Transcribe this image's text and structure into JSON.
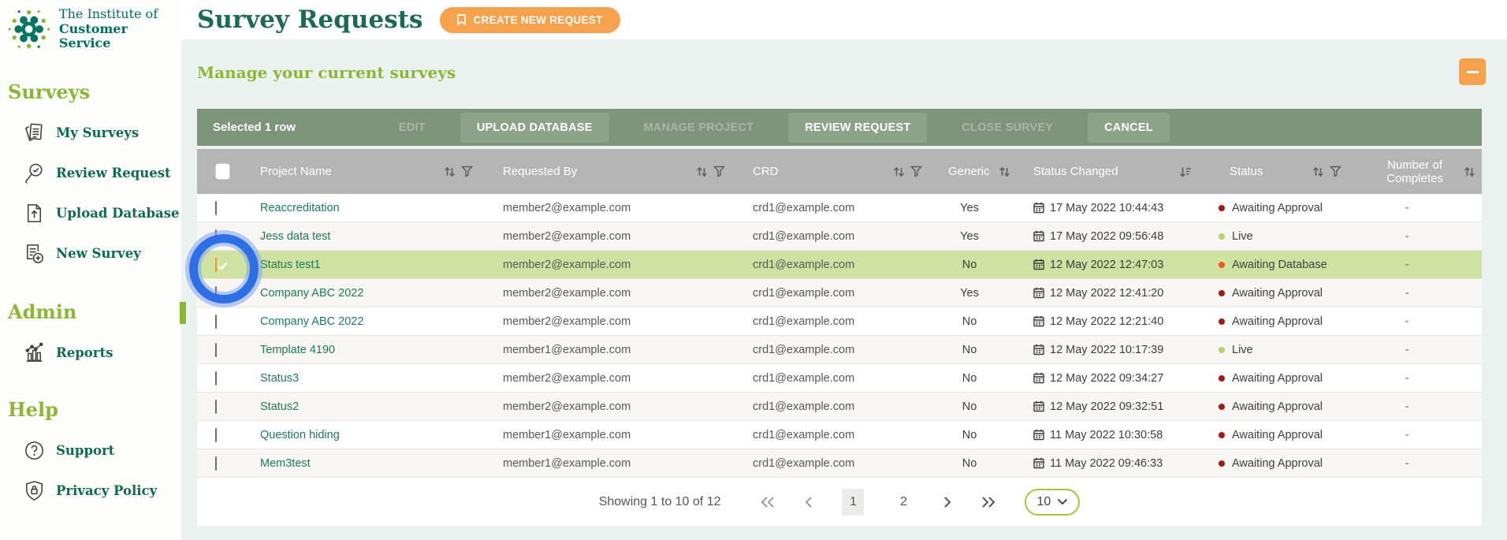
{
  "brand": {
    "name_line1": "The Institute of",
    "name_line2": "Customer Service"
  },
  "sidebar": {
    "sections": [
      {
        "heading": "Surveys",
        "items": [
          {
            "label": "My Surveys",
            "icon": "documents-icon"
          },
          {
            "label": "Review Request",
            "icon": "magnifier-check-icon"
          },
          {
            "label": "Upload Database",
            "icon": "upload-document-icon"
          },
          {
            "label": "New Survey",
            "icon": "new-document-icon"
          }
        ]
      },
      {
        "heading": "Admin",
        "items": [
          {
            "label": "Reports",
            "icon": "bar-chart-icon"
          }
        ]
      },
      {
        "heading": "Help",
        "items": [
          {
            "label": "Support",
            "icon": "question-circle-icon"
          },
          {
            "label": "Privacy Policy",
            "icon": "shield-lock-icon"
          }
        ]
      }
    ]
  },
  "header": {
    "title": "Survey Requests",
    "create_button": "CREATE NEW REQUEST",
    "section_title": "Manage your current surveys"
  },
  "toolbar": {
    "selected_text": "Selected 1 row",
    "buttons": [
      {
        "label": "EDIT",
        "enabled": false
      },
      {
        "label": "UPLOAD DATABASE",
        "enabled": true
      },
      {
        "label": "MANAGE PROJECT",
        "enabled": false
      },
      {
        "label": "REVIEW REQUEST",
        "enabled": true
      },
      {
        "label": "CLOSE SURVEY",
        "enabled": false
      },
      {
        "label": "CANCEL",
        "enabled": true
      }
    ]
  },
  "table": {
    "columns": [
      "Project Name",
      "Requested By",
      "CRD",
      "Generic",
      "Status Changed",
      "Status",
      "Number of Completes"
    ],
    "rows": [
      {
        "project": "Reaccreditation",
        "requested_by": "member2@example.com",
        "crd": "crd1@example.com",
        "generic": "Yes",
        "status_changed": "17 May 2022 10:44:43",
        "status": "Awaiting Approval",
        "completes": "-",
        "checked": false,
        "highlight": false
      },
      {
        "project": "Jess data test",
        "requested_by": "member2@example.com",
        "crd": "crd1@example.com",
        "generic": "Yes",
        "status_changed": "17 May 2022 09:56:48",
        "status": "Live",
        "completes": "-",
        "checked": false,
        "highlight": false
      },
      {
        "project": "Status test1",
        "requested_by": "member2@example.com",
        "crd": "crd1@example.com",
        "generic": "No",
        "status_changed": "12 May 2022 12:47:03",
        "status": "Awaiting Database",
        "completes": "-",
        "checked": true,
        "highlight": true
      },
      {
        "project": "Company ABC 2022",
        "requested_by": "member2@example.com",
        "crd": "crd1@example.com",
        "generic": "Yes",
        "status_changed": "12 May 2022 12:41:20",
        "status": "Awaiting Approval",
        "completes": "-",
        "checked": false,
        "highlight": false
      },
      {
        "project": "Company ABC 2022",
        "requested_by": "member2@example.com",
        "crd": "crd1@example.com",
        "generic": "No",
        "status_changed": "12 May 2022 12:21:40",
        "status": "Awaiting Approval",
        "completes": "-",
        "checked": false,
        "highlight": false
      },
      {
        "project": "Template 4190",
        "requested_by": "member1@example.com",
        "crd": "crd1@example.com",
        "generic": "No",
        "status_changed": "12 May 2022 10:17:39",
        "status": "Live",
        "completes": "-",
        "checked": false,
        "highlight": false
      },
      {
        "project": "Status3",
        "requested_by": "member2@example.com",
        "crd": "crd1@example.com",
        "generic": "No",
        "status_changed": "12 May 2022 09:34:27",
        "status": "Awaiting Approval",
        "completes": "-",
        "checked": false,
        "highlight": false
      },
      {
        "project": "Status2",
        "requested_by": "member2@example.com",
        "crd": "crd1@example.com",
        "generic": "No",
        "status_changed": "12 May 2022 09:32:51",
        "status": "Awaiting Approval",
        "completes": "-",
        "checked": false,
        "highlight": false
      },
      {
        "project": "Question hiding",
        "requested_by": "member1@example.com",
        "crd": "crd1@example.com",
        "generic": "No",
        "status_changed": "11 May 2022 10:30:58",
        "status": "Awaiting Approval",
        "completes": "-",
        "checked": false,
        "highlight": false
      },
      {
        "project": "Mem3test",
        "requested_by": "member1@example.com",
        "crd": "crd1@example.com",
        "generic": "No",
        "status_changed": "11 May 2022 09:46:33",
        "status": "Awaiting Approval",
        "completes": "-",
        "checked": false,
        "highlight": false
      }
    ]
  },
  "pagination": {
    "showing_text": "Showing 1 to 10 of 12",
    "pages": [
      "1",
      "2"
    ],
    "current_page": "1",
    "page_size": "10"
  },
  "colors": {
    "brand_green": "#00705f",
    "title_green": "#1d6a52",
    "light_green": "#8bb734",
    "accent_orange": "#f6a14c",
    "toolbar_green": "#7e947b",
    "header_gray": "#b5b5b5",
    "highlight_row": "#cfe2a2",
    "checked_checkbox_orange": "#f7941d",
    "annotation_blue": "#2e6fe6",
    "status": {
      "Awaiting Approval": "#9e1a13",
      "Live": "#b9d36d",
      "Awaiting Database": "#ee5a24"
    }
  }
}
